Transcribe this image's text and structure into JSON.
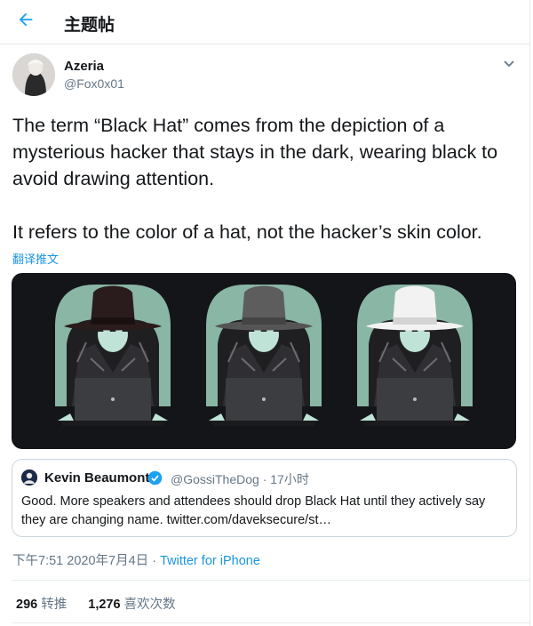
{
  "header": {
    "title": "主题帖",
    "back_icon": "arrow-left-icon"
  },
  "author": {
    "name": "Azeria",
    "handle": "@Fox0x01"
  },
  "tweet": {
    "paragraphs": [
      "The term “Black Hat” comes from the depiction of a mysterious hacker that stays in the dark, wearing black to avoid drawing attention.",
      "It refers to the color of a hat, not the hacker’s skin color."
    ],
    "translate_label": "翻译推文"
  },
  "media": {
    "hat_colors": [
      "#2a1c1c",
      "#555555",
      "#f2f2f2"
    ],
    "icon": "hacker-illustration"
  },
  "quote": {
    "name": "Kevin Beaumont",
    "handle": "@GossiTheDog",
    "time": "17小时",
    "text": "Good. More speakers and attendees should drop Black Hat until they actively say they are changing name. twitter.com/davek­secure/st…"
  },
  "meta": {
    "time": "下午7:51",
    "date": "2020年7月4日",
    "separator": "·",
    "source": "Twitter for iPhone"
  },
  "stats": {
    "retweets": "296",
    "retweets_label": "转推",
    "likes": "1,276",
    "likes_label": "喜欢次数"
  },
  "colors": {
    "accent": "#1da1f2",
    "border": "#e6ecf0",
    "muted": "#657786"
  }
}
